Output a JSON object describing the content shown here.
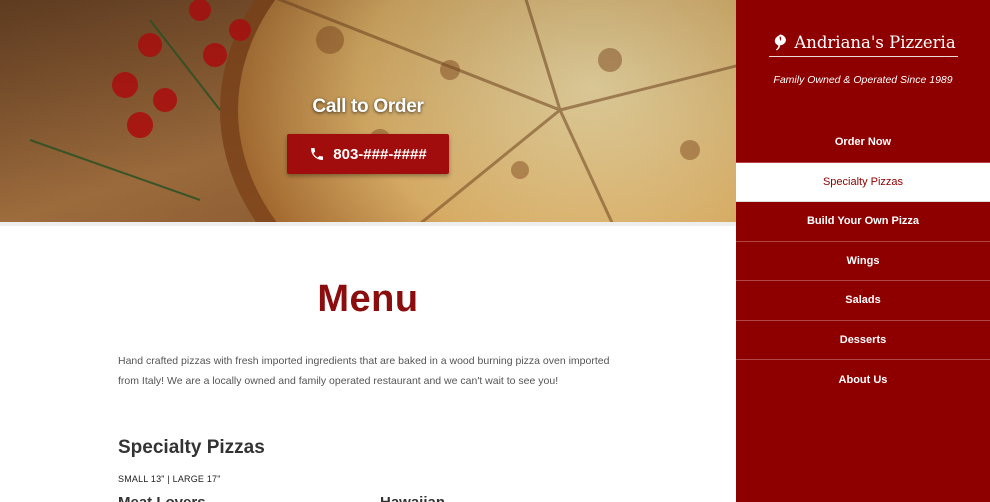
{
  "hero": {
    "title": "Call to Order",
    "phone": "803-###-####"
  },
  "main": {
    "heading": "Menu",
    "intro": "Hand crafted pizzas with fresh imported ingredients that are baked in a wood burning pizza oven imported from Italy! We are a locally owned and family operated restaurant and we can't wait to see you!",
    "section_title": "Specialty Pizzas",
    "sizes": "SMALL 13\" | LARGE 17\"",
    "cut_items": [
      "Meat Lovers",
      "Hawaiian"
    ]
  },
  "sidebar": {
    "brand": "Andriana's Pizzeria",
    "tagline": "Family Owned & Operated Since 1989",
    "nav": [
      {
        "label": "Order Now"
      },
      {
        "label": "Specialty Pizzas",
        "active": true
      },
      {
        "label": "Build Your Own Pizza"
      },
      {
        "label": "Wings"
      },
      {
        "label": "Salads"
      },
      {
        "label": "Desserts"
      },
      {
        "label": "About Us"
      }
    ]
  },
  "colors": {
    "brand_red": "#8e0000",
    "heading_red": "#8b0d0d",
    "button_red": "#a10c0c"
  },
  "icons": {
    "phone": "phone-icon",
    "brand": "leaf-icon"
  }
}
